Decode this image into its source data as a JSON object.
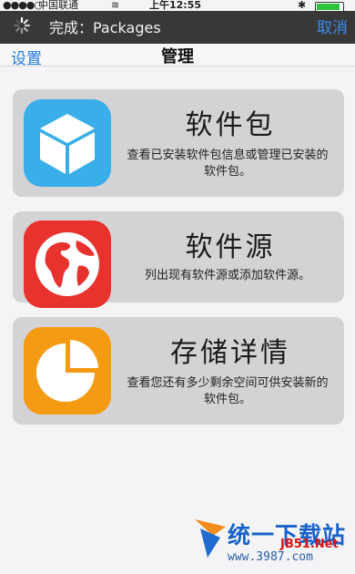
{
  "status_bar": {
    "signal": "●●●●○",
    "carrier": "中国联通",
    "wifi": "≋",
    "time": "上午12:55",
    "bluetooth": "✱",
    "battery_level": 0.9,
    "battery_color": "#2bc33d"
  },
  "nav": {
    "back_label": "设置",
    "title": "管理"
  },
  "progress": {
    "status_text": "完成：Packages",
    "cancel_label": "取消"
  },
  "menu": [
    {
      "title": "软件包",
      "description": "查看已安装软件包信息或管理已安装的软件包。",
      "icon": "package-icon",
      "color": "#3aaee8"
    },
    {
      "title": "软件源",
      "description": "列出现有软件源或添加软件源。",
      "icon": "globe-icon",
      "color": "#e8322e"
    },
    {
      "title": "存储详情",
      "description": "查看您还有多少剩余空间可供安装新的软件包。",
      "icon": "pie-chart-icon",
      "color": "#f59a13"
    }
  ],
  "watermark": {
    "name": "统一下载站",
    "url": "www.3987.com",
    "url_overlay": "JB51.Net"
  }
}
